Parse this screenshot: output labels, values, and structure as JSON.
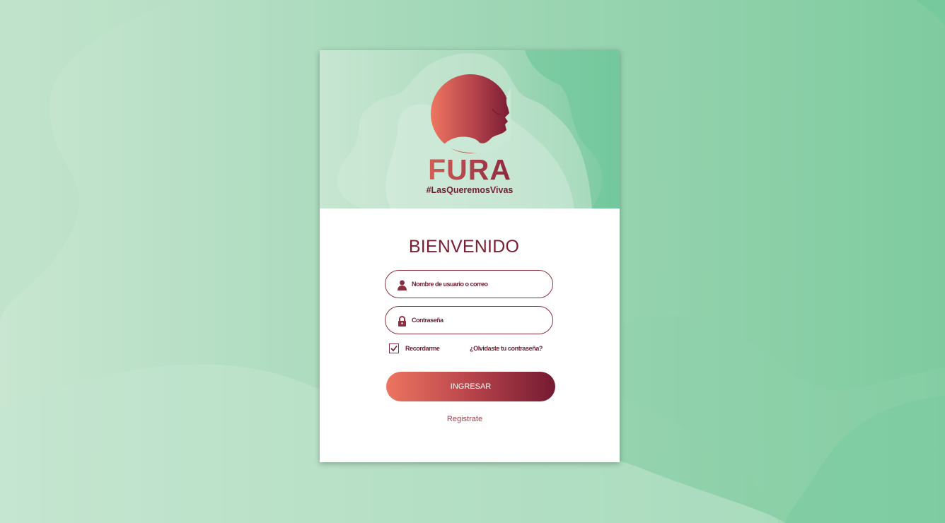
{
  "brand": {
    "name": "FURA",
    "tagline": "#LasQueremosVivas",
    "emblem_icon": "woman-profile-logo-icon"
  },
  "login": {
    "title": "BIENVENIDO",
    "username_placeholder": "Nombre de usuario o correo",
    "password_placeholder": "Contraseña",
    "remember_label": "Recordarme",
    "remember_checked": true,
    "forgot_label": "¿Olvidaste tu contraseña?",
    "submit_label": "INGRESAR",
    "register_label": "Registrate"
  },
  "icons": {
    "username": "user-icon",
    "password": "lock-icon",
    "remember": "checkmark-icon"
  },
  "colors": {
    "accent_dark": "#7a1e33",
    "accent_light": "#ec7560",
    "background_green": "#a3d8b8"
  }
}
